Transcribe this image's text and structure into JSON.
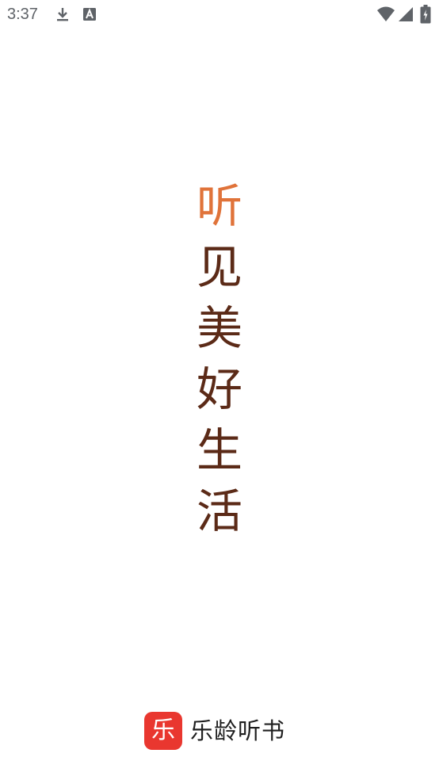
{
  "status_bar": {
    "time": "3:37",
    "icons": [
      "download-icon",
      "text-a-icon",
      "wifi-icon",
      "signal-icon",
      "battery-icon"
    ],
    "icon_color": "#5f6368"
  },
  "slogan": {
    "chars": [
      "听",
      "见",
      "美",
      "好",
      "生",
      "活"
    ],
    "accent_color": "#e0733a",
    "text_color": "#5b2a17"
  },
  "brand": {
    "logo_glyph": "乐",
    "name": "乐龄听书",
    "logo_color": "#e9372f"
  }
}
